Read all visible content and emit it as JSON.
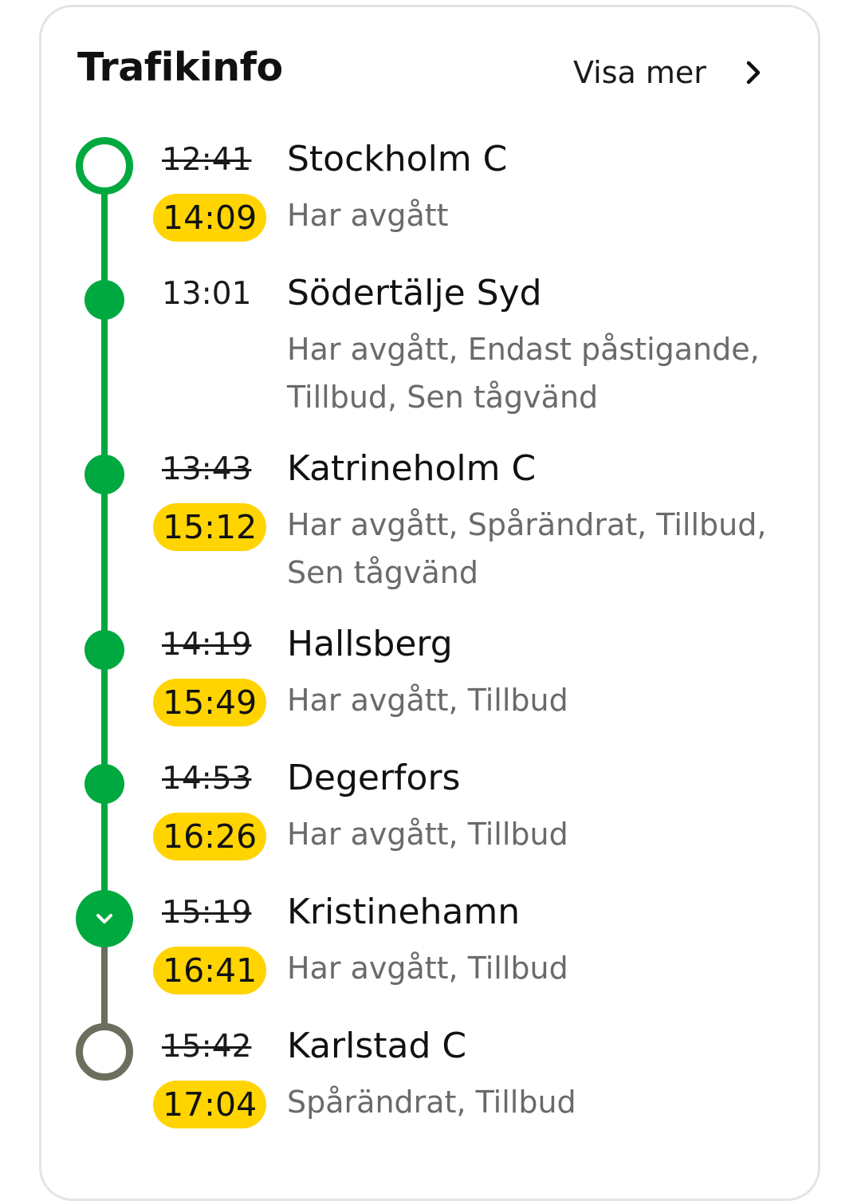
{
  "header": {
    "title": "Trafikinfo",
    "more_label": "Visa mer"
  },
  "colors": {
    "passed_line": "#00a93f",
    "upcoming_line": "#6e6e5e",
    "delay_badge": "#ffd400",
    "status_text": "#6a6a6a"
  },
  "stops": [
    {
      "planned": "12:41",
      "actual": "14:09",
      "station": "Stockholm C",
      "status": "Har avgått"
    },
    {
      "planned": "13:01",
      "actual": "",
      "station": "Södertälje Syd",
      "status": "Har avgått, Endast påstigande, Tillbud, Sen tågvänd"
    },
    {
      "planned": "13:43",
      "actual": "15:12",
      "station": "Katrineholm C",
      "status": "Har avgått, Spårändrat, Tillbud, Sen tågvänd"
    },
    {
      "planned": "14:19",
      "actual": "15:49",
      "station": "Hallsberg",
      "status": "Har avgått, Tillbud"
    },
    {
      "planned": "14:53",
      "actual": "16:26",
      "station": "Degerfors",
      "status": "Har avgått, Tillbud"
    },
    {
      "planned": "15:19",
      "actual": "16:41",
      "station": "Kristinehamn",
      "status": "Har avgått, Tillbud"
    },
    {
      "planned": "15:42",
      "actual": "17:04",
      "station": "Karlstad C",
      "status": "Spårändrat, Tillbud"
    }
  ]
}
